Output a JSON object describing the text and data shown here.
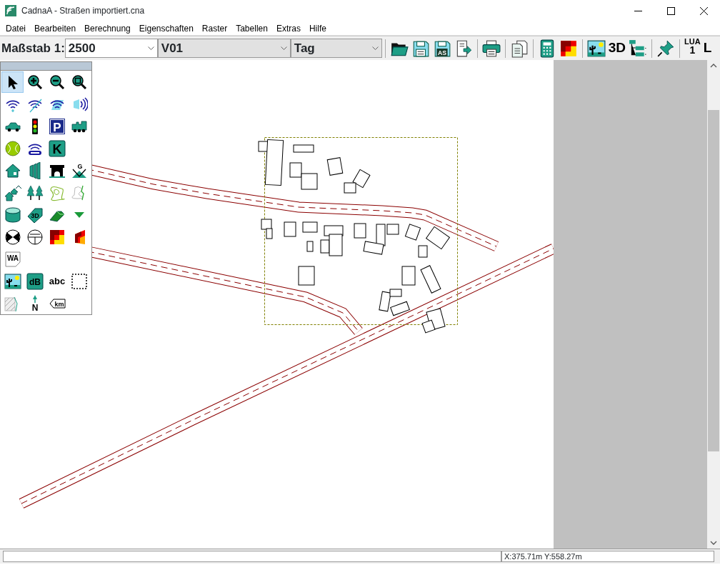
{
  "window": {
    "title": "CadnaA - Straßen importiert.cna"
  },
  "menu": [
    "Datei",
    "Bearbeiten",
    "Berechnung",
    "Eigenschaften",
    "Raster",
    "Tabellen",
    "Extras",
    "Hilfe"
  ],
  "toolbar": {
    "scale_label": "Maßstab 1:",
    "scale_value": "2500",
    "variant": "V01",
    "period": "Tag",
    "groups": [
      [
        {
          "kind": "open"
        },
        {
          "kind": "save"
        },
        {
          "kind": "saveas",
          "text": "AS"
        },
        {
          "kind": "export"
        }
      ],
      [
        {
          "kind": "print"
        }
      ],
      [
        {
          "kind": "copy"
        }
      ],
      [
        {
          "kind": "calculator"
        },
        {
          "kind": "grid"
        }
      ],
      [
        {
          "kind": "landscape"
        },
        {
          "kind": "label",
          "text": "3D"
        },
        {
          "kind": "tree"
        }
      ],
      [
        {
          "kind": "pin"
        }
      ],
      [
        {
          "kind": "lua",
          "text": "LUA",
          "sub": "1"
        },
        {
          "kind": "label",
          "text": "L"
        }
      ]
    ]
  },
  "palette": {
    "rows": [
      [
        {
          "kind": "pointer",
          "selected": true
        },
        {
          "kind": "zoom-in",
          "selected": false
        },
        {
          "kind": "zoom-out",
          "selected": false
        },
        {
          "kind": "zoom-fit",
          "selected": false
        }
      ],
      [
        {
          "kind": "source-point",
          "selected": false
        },
        {
          "kind": "source-line",
          "selected": false
        },
        {
          "kind": "source-area",
          "selected": false
        },
        {
          "kind": "source-vertical",
          "selected": false
        }
      ],
      [
        {
          "kind": "car",
          "selected": false
        },
        {
          "kind": "traffic-light",
          "selected": false
        },
        {
          "kind": "parking",
          "text": "P",
          "selected": false
        },
        {
          "kind": "train",
          "selected": false
        }
      ],
      [
        {
          "kind": "ball",
          "selected": false
        },
        {
          "kind": "antenna",
          "selected": false
        },
        {
          "kind": "k-badge",
          "text": "K",
          "selected": false
        }
      ],
      [
        {
          "kind": "house",
          "selected": false
        },
        {
          "kind": "wall",
          "selected": false
        },
        {
          "kind": "bridge",
          "selected": false
        },
        {
          "kind": "embankment",
          "text": "G",
          "selected": false
        }
      ],
      [
        {
          "kind": "houses",
          "selected": false
        },
        {
          "kind": "trees",
          "selected": false
        },
        {
          "kind": "area",
          "selected": false
        },
        {
          "kind": "contour",
          "selected": false
        }
      ],
      [
        {
          "kind": "cylinder",
          "selected": false
        },
        {
          "kind": "tag3d",
          "text": "3D",
          "selected": false
        },
        {
          "kind": "wedge",
          "selected": false
        },
        {
          "kind": "triangle",
          "selected": false
        }
      ],
      [
        {
          "kind": "crossing",
          "selected": false
        },
        {
          "kind": "sections",
          "selected": false
        },
        {
          "kind": "grid",
          "selected": false
        },
        {
          "kind": "grid-side",
          "selected": false
        }
      ],
      [
        {
          "kind": "doc",
          "text": "WA",
          "selected": false
        }
      ],
      [
        {
          "kind": "landscape",
          "selected": false
        },
        {
          "kind": "db",
          "text": "dB",
          "selected": false
        },
        {
          "kind": "textlabel",
          "text": "abc",
          "selected": false
        },
        {
          "kind": "dotted",
          "selected": false
        }
      ],
      [
        {
          "kind": "hatched",
          "selected": false
        },
        {
          "kind": "north",
          "text": "N",
          "selected": false
        },
        {
          "kind": "km",
          "text": "km",
          "selected": false
        }
      ]
    ]
  },
  "status_bar": {
    "coordinates": "X:375.71m Y:558.27m"
  }
}
